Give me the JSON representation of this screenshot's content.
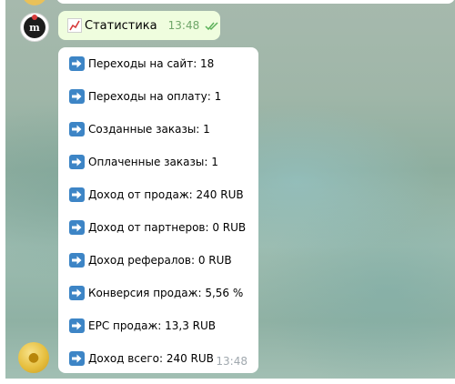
{
  "title_message": {
    "text": "Статистика",
    "time": "13:48"
  },
  "stats_message": {
    "time": "13:48",
    "rows": [
      "Переходы на сайт: 18",
      "Переходы на оплату: 1",
      "Созданные заказы: 1",
      "Оплаченные заказы: 1",
      "Доход от продаж: 240 RUB",
      "Доход от партнеров: 0 RUB",
      "Доход рефералов: 0 RUB",
      "Конверсия продаж: 5,56 %",
      "EPC продаж: 13,3 RUB",
      "Доход всего: 240 RUB"
    ]
  },
  "colors": {
    "outgoing_bubble": "#effdde",
    "incoming_bubble": "#ffffff",
    "check_color": "#5cb25a",
    "arrow_icon_bg": "#3d85c6"
  },
  "icons": {
    "title": "chart-increasing-icon",
    "row": "right-arrow-icon",
    "read_status": "double-check-icon"
  }
}
